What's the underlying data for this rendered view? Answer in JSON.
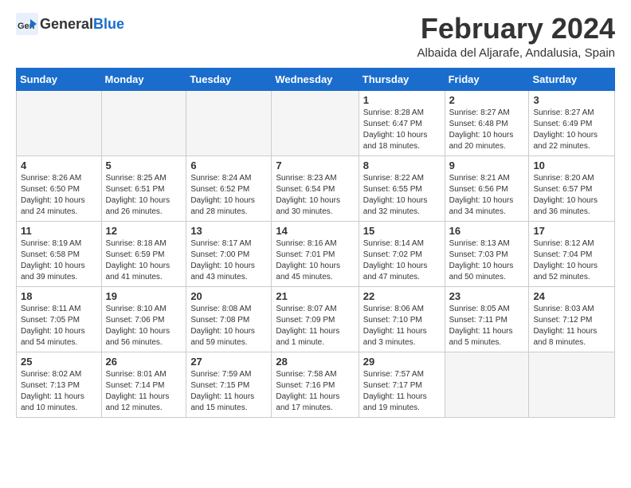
{
  "header": {
    "logo_general": "General",
    "logo_blue": "Blue",
    "month_title": "February 2024",
    "location": "Albaida del Aljarafe, Andalusia, Spain"
  },
  "days_of_week": [
    "Sunday",
    "Monday",
    "Tuesday",
    "Wednesday",
    "Thursday",
    "Friday",
    "Saturday"
  ],
  "weeks": [
    [
      {
        "day": "",
        "info": ""
      },
      {
        "day": "",
        "info": ""
      },
      {
        "day": "",
        "info": ""
      },
      {
        "day": "",
        "info": ""
      },
      {
        "day": "1",
        "info": "Sunrise: 8:28 AM\nSunset: 6:47 PM\nDaylight: 10 hours\nand 18 minutes."
      },
      {
        "day": "2",
        "info": "Sunrise: 8:27 AM\nSunset: 6:48 PM\nDaylight: 10 hours\nand 20 minutes."
      },
      {
        "day": "3",
        "info": "Sunrise: 8:27 AM\nSunset: 6:49 PM\nDaylight: 10 hours\nand 22 minutes."
      }
    ],
    [
      {
        "day": "4",
        "info": "Sunrise: 8:26 AM\nSunset: 6:50 PM\nDaylight: 10 hours\nand 24 minutes."
      },
      {
        "day": "5",
        "info": "Sunrise: 8:25 AM\nSunset: 6:51 PM\nDaylight: 10 hours\nand 26 minutes."
      },
      {
        "day": "6",
        "info": "Sunrise: 8:24 AM\nSunset: 6:52 PM\nDaylight: 10 hours\nand 28 minutes."
      },
      {
        "day": "7",
        "info": "Sunrise: 8:23 AM\nSunset: 6:54 PM\nDaylight: 10 hours\nand 30 minutes."
      },
      {
        "day": "8",
        "info": "Sunrise: 8:22 AM\nSunset: 6:55 PM\nDaylight: 10 hours\nand 32 minutes."
      },
      {
        "day": "9",
        "info": "Sunrise: 8:21 AM\nSunset: 6:56 PM\nDaylight: 10 hours\nand 34 minutes."
      },
      {
        "day": "10",
        "info": "Sunrise: 8:20 AM\nSunset: 6:57 PM\nDaylight: 10 hours\nand 36 minutes."
      }
    ],
    [
      {
        "day": "11",
        "info": "Sunrise: 8:19 AM\nSunset: 6:58 PM\nDaylight: 10 hours\nand 39 minutes."
      },
      {
        "day": "12",
        "info": "Sunrise: 8:18 AM\nSunset: 6:59 PM\nDaylight: 10 hours\nand 41 minutes."
      },
      {
        "day": "13",
        "info": "Sunrise: 8:17 AM\nSunset: 7:00 PM\nDaylight: 10 hours\nand 43 minutes."
      },
      {
        "day": "14",
        "info": "Sunrise: 8:16 AM\nSunset: 7:01 PM\nDaylight: 10 hours\nand 45 minutes."
      },
      {
        "day": "15",
        "info": "Sunrise: 8:14 AM\nSunset: 7:02 PM\nDaylight: 10 hours\nand 47 minutes."
      },
      {
        "day": "16",
        "info": "Sunrise: 8:13 AM\nSunset: 7:03 PM\nDaylight: 10 hours\nand 50 minutes."
      },
      {
        "day": "17",
        "info": "Sunrise: 8:12 AM\nSunset: 7:04 PM\nDaylight: 10 hours\nand 52 minutes."
      }
    ],
    [
      {
        "day": "18",
        "info": "Sunrise: 8:11 AM\nSunset: 7:05 PM\nDaylight: 10 hours\nand 54 minutes."
      },
      {
        "day": "19",
        "info": "Sunrise: 8:10 AM\nSunset: 7:06 PM\nDaylight: 10 hours\nand 56 minutes."
      },
      {
        "day": "20",
        "info": "Sunrise: 8:08 AM\nSunset: 7:08 PM\nDaylight: 10 hours\nand 59 minutes."
      },
      {
        "day": "21",
        "info": "Sunrise: 8:07 AM\nSunset: 7:09 PM\nDaylight: 11 hours\nand 1 minute."
      },
      {
        "day": "22",
        "info": "Sunrise: 8:06 AM\nSunset: 7:10 PM\nDaylight: 11 hours\nand 3 minutes."
      },
      {
        "day": "23",
        "info": "Sunrise: 8:05 AM\nSunset: 7:11 PM\nDaylight: 11 hours\nand 5 minutes."
      },
      {
        "day": "24",
        "info": "Sunrise: 8:03 AM\nSunset: 7:12 PM\nDaylight: 11 hours\nand 8 minutes."
      }
    ],
    [
      {
        "day": "25",
        "info": "Sunrise: 8:02 AM\nSunset: 7:13 PM\nDaylight: 11 hours\nand 10 minutes."
      },
      {
        "day": "26",
        "info": "Sunrise: 8:01 AM\nSunset: 7:14 PM\nDaylight: 11 hours\nand 12 minutes."
      },
      {
        "day": "27",
        "info": "Sunrise: 7:59 AM\nSunset: 7:15 PM\nDaylight: 11 hours\nand 15 minutes."
      },
      {
        "day": "28",
        "info": "Sunrise: 7:58 AM\nSunset: 7:16 PM\nDaylight: 11 hours\nand 17 minutes."
      },
      {
        "day": "29",
        "info": "Sunrise: 7:57 AM\nSunset: 7:17 PM\nDaylight: 11 hours\nand 19 minutes."
      },
      {
        "day": "",
        "info": ""
      },
      {
        "day": "",
        "info": ""
      }
    ]
  ]
}
